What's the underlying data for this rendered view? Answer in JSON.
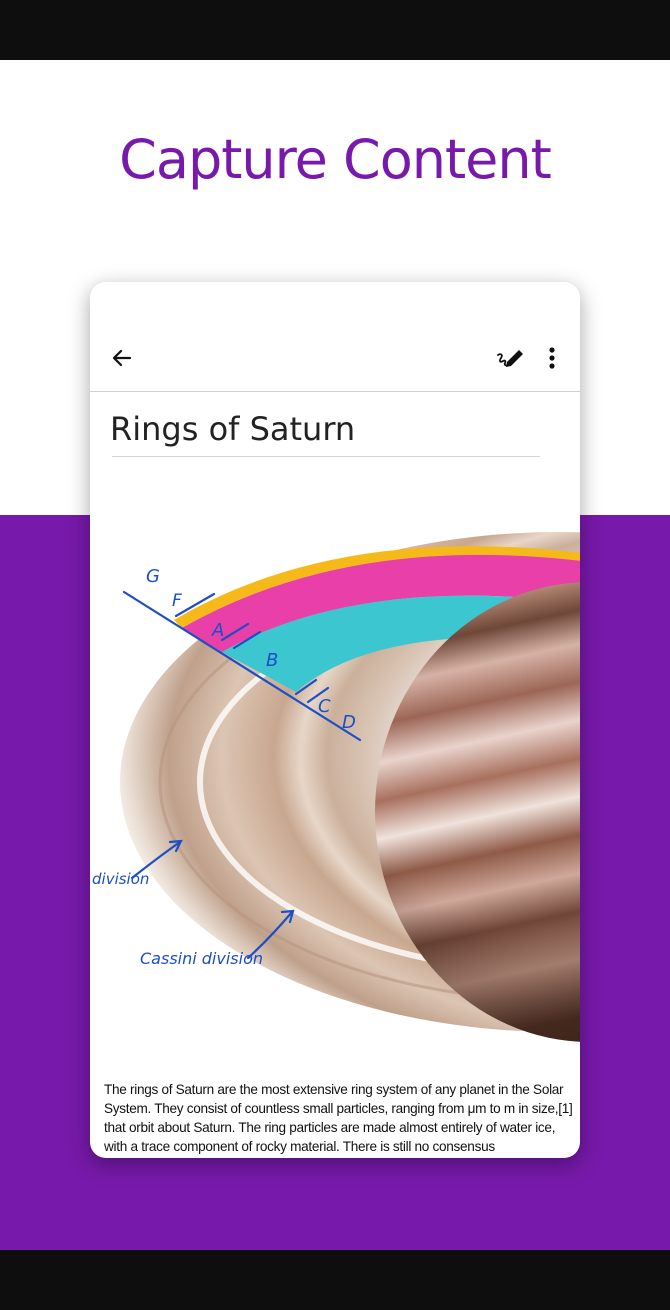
{
  "headline": "Capture Content",
  "note": {
    "title": "Rings of Saturn",
    "body": "The rings of Saturn are the most extensive ring system of any planet in the Solar System. They consist of countless small particles, ranging from μm to m in size,[1] that orbit about Saturn. The ring particles are made almost entirely of water ice, with a trace component of rocky material. There is still no consensus"
  },
  "toolbar": {
    "back_icon": "back-arrow-icon",
    "pen_icon": "ink-pen-icon",
    "more_icon": "more-vertical-icon"
  },
  "annotations": {
    "ring_g": "G",
    "ring_f": "F",
    "ring_a": "A",
    "ring_b": "B",
    "ring_c": "C",
    "ring_d": "D",
    "division_left": "division",
    "cassini": "Cassini division"
  },
  "colors": {
    "brand_purple": "#7719aa",
    "ink_blue": "#1d4fc4",
    "ring_yellow": "#f6b91a",
    "ring_pink": "#e83fa8",
    "ring_teal": "#3cc6cf"
  }
}
